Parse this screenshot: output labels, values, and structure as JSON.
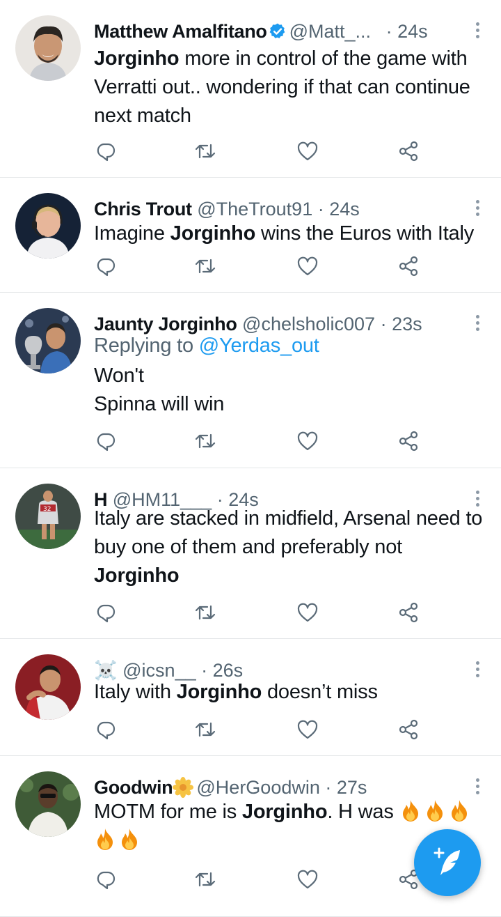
{
  "tweets": [
    {
      "name": "Matthew Amalfitano",
      "verified": true,
      "handle": "@Matt_...",
      "time": "· 24s",
      "body_segments": [
        {
          "text": "Jorginho",
          "bold": true
        },
        {
          "text": " more in control of the game with Verratti out.. wondering if that can continue next match",
          "bold": false
        }
      ],
      "avatar_icon": "avatar-smiling-man"
    },
    {
      "name": "Chris Trout",
      "handle": "@TheTrout91",
      "time": "· 24s",
      "body_segments": [
        {
          "text": "Imagine ",
          "bold": false
        },
        {
          "text": "Jorginho",
          "bold": true
        },
        {
          "text": " wins the Euros with Italy",
          "bold": false
        }
      ],
      "avatar_icon": "avatar-headset-man"
    },
    {
      "name": "Jaunty Jorginho",
      "handle": "@chelsholic007",
      "time": "· 23s",
      "replying_label": "Replying to",
      "replying_to": "@Yerdas_out",
      "body_lines": [
        "Won't",
        "Spinna will win"
      ],
      "avatar_icon": "avatar-trophy-player"
    },
    {
      "name": "H",
      "handle": "@HM11___",
      "time": "· 24s",
      "body_segments": [
        {
          "text": "Italy are stacked in midfield, Arsenal need to buy one of them and preferably not ",
          "bold": false
        },
        {
          "text": "Jorginho",
          "bold": true
        }
      ],
      "avatar_icon": "avatar-arsenal-player"
    },
    {
      "name_emoji": "☠️",
      "handle": "@icsn__",
      "time": "· 26s",
      "body_segments": [
        {
          "text": "Italy with ",
          "bold": false
        },
        {
          "text": "Jorginho",
          "bold": true
        },
        {
          "text": " doesn’t miss",
          "bold": false
        }
      ],
      "avatar_icon": "avatar-red-kit-player"
    },
    {
      "name": "Goodwin",
      "name_emoji": "🌼",
      "handle": "@HerGoodwin",
      "time": "· 27s",
      "body_segments": [
        {
          "text": "MOTM for me is ",
          "bold": false
        },
        {
          "text": "Jorginho",
          "bold": true
        },
        {
          "text": ". H was ",
          "bold": false
        }
      ],
      "fire_count": 5,
      "avatar_icon": "avatar-white-shirt-man"
    }
  ],
  "actions": [
    "reply-icon",
    "retweet-icon",
    "like-icon",
    "share-icon"
  ],
  "colors": {
    "accent": "#1d9bf0",
    "text": "#0f1419",
    "muted": "#536471",
    "divider": "#e3e6e8",
    "icon": "#5b6b78"
  },
  "fab_icon": "compose-tweet-icon"
}
